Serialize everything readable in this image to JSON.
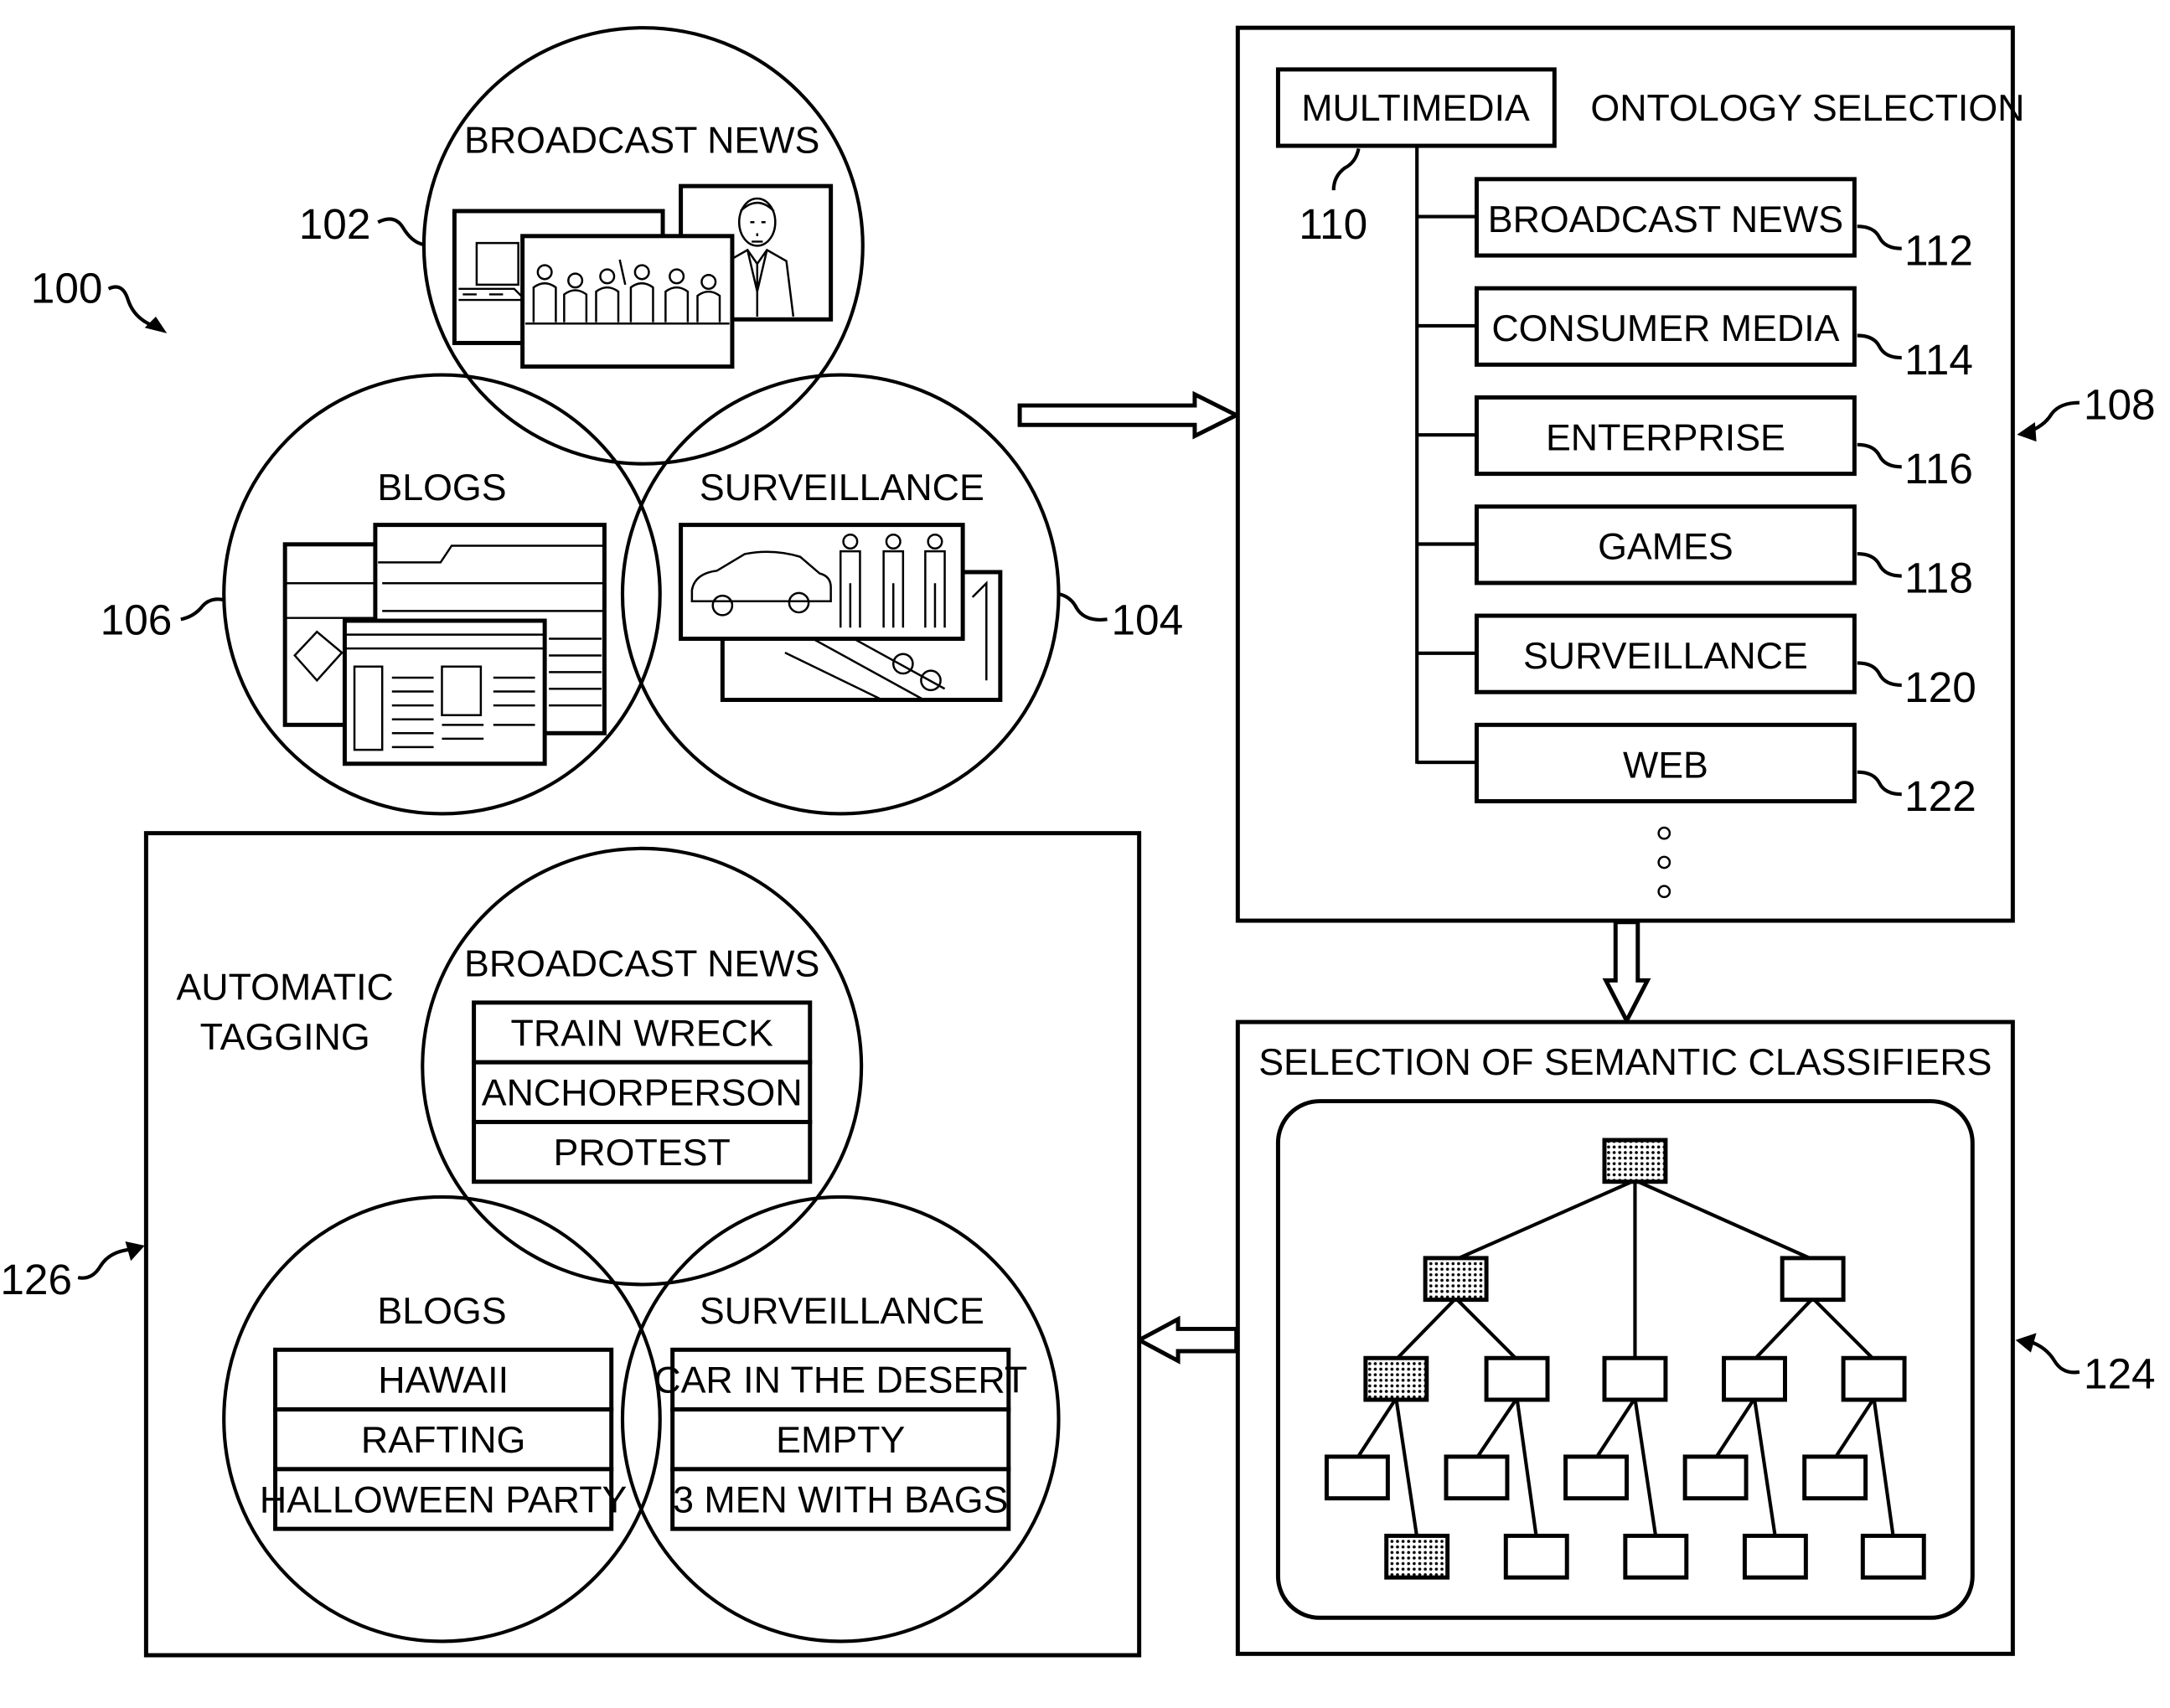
{
  "figure_ref": "100",
  "input_venn": {
    "ref_broadcast": "102",
    "ref_surveillance": "104",
    "ref_blogs": "106",
    "broadcast_label": "BROADCAST NEWS",
    "blogs_label": "BLOGS",
    "surveillance_label": "SURVEILLANCE"
  },
  "ontology": {
    "ref": "108",
    "title": "ONTOLOGY SELECTION",
    "root_label": "MULTIMEDIA",
    "root_ref": "110",
    "items": [
      {
        "label": "BROADCAST NEWS",
        "ref": "112"
      },
      {
        "label": "CONSUMER MEDIA",
        "ref": "114"
      },
      {
        "label": "ENTERPRISE",
        "ref": "116"
      },
      {
        "label": "GAMES",
        "ref": "118"
      },
      {
        "label": "SURVEILLANCE",
        "ref": "120"
      },
      {
        "label": "WEB",
        "ref": "122"
      }
    ]
  },
  "classifiers": {
    "ref": "124",
    "title": "SELECTION OF SEMANTIC CLASSIFIERS"
  },
  "tagging": {
    "ref": "126",
    "title_line1": "AUTOMATIC",
    "title_line2": "TAGGING",
    "broadcast_label": "BROADCAST NEWS",
    "broadcast_tags": [
      "TRAIN WRECK",
      "ANCHORPERSON",
      "PROTEST"
    ],
    "blogs_label": "BLOGS",
    "blogs_tags": [
      "HAWAII",
      "RAFTING",
      "HALLOWEEN PARTY"
    ],
    "surveillance_label": "SURVEILLANCE",
    "surveillance_tags": [
      "CAR IN THE DESERT",
      "EMPTY",
      "3 MEN WITH BAGS"
    ]
  }
}
